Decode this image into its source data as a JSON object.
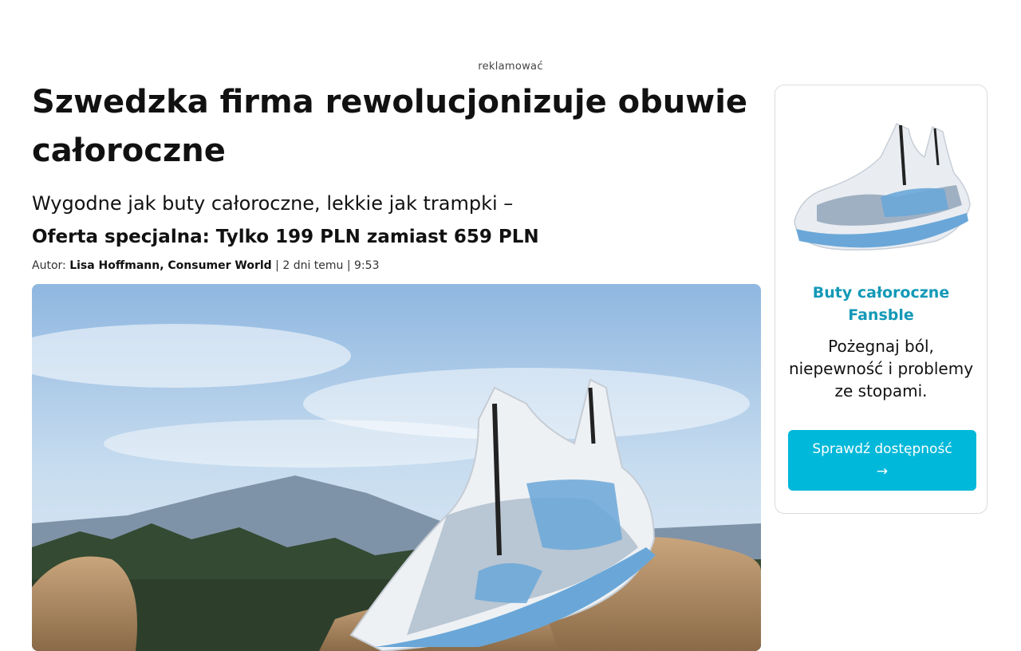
{
  "ad_label": "reklamować",
  "article": {
    "headline": "Szwedzka firma rewolucjonizuje obuwie całoroczne",
    "subheadline": "Wygodne jak buty całoroczne, lekkie jak trampki –",
    "offer": "Oferta specjalna: Tylko 199 PLN zamiast 659 PLN",
    "byline": {
      "prefix": "Autor:",
      "author": "Lisa Hoffmann, Consumer World",
      "separator1": "|",
      "date": "2 dni temu",
      "separator2": "|",
      "time": "9:53"
    }
  },
  "sidebar": {
    "product_title": "Buty całoroczne Fansble",
    "product_text": "Pożegnaj ból, niepewność i problemy ze stopami.",
    "cta_label": "Sprawdź dostępność",
    "cta_arrow": "→"
  },
  "colors": {
    "accent": "#1399b7",
    "button": "#00b8d9",
    "sky": "#a9c8e6",
    "shoe_accent": "#6aa7d8"
  },
  "icons": {
    "hero_image": "sneaker-on-rocks-photo",
    "sidebar_image": "sneaker-product-photo"
  }
}
